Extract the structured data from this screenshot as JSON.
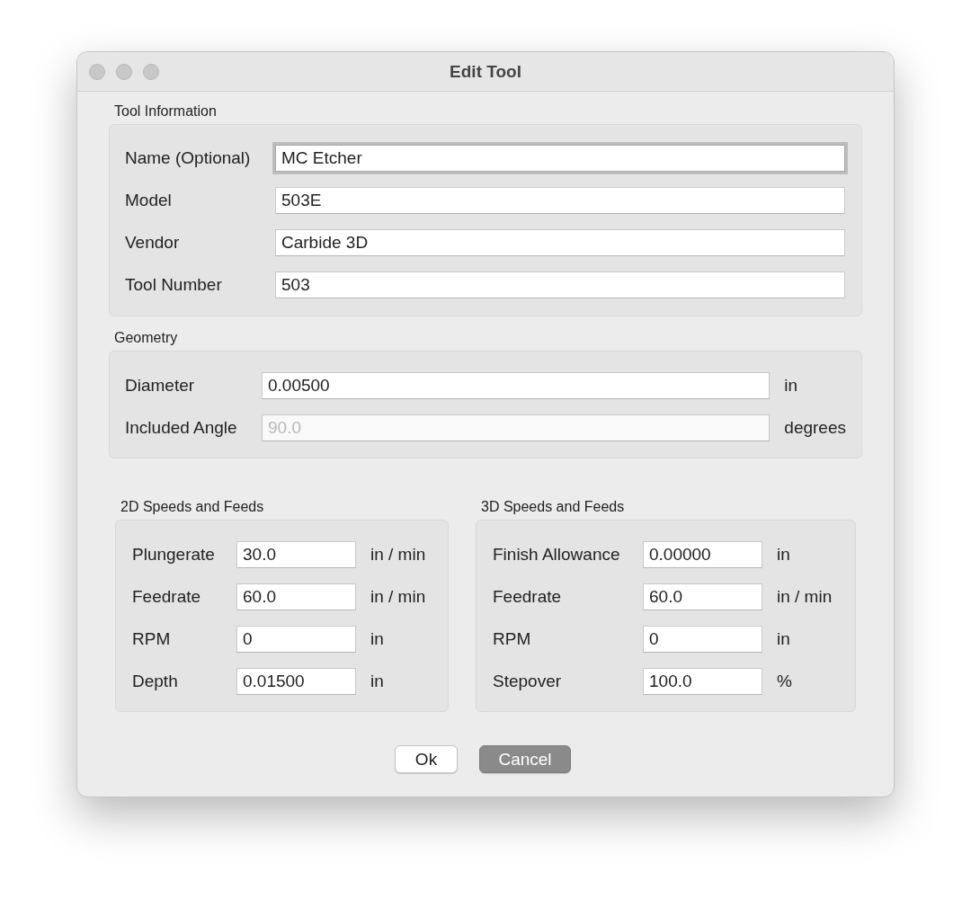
{
  "window": {
    "title": "Edit Tool"
  },
  "tool_information": {
    "title": "Tool Information",
    "fields": [
      {
        "label": "Name (Optional)",
        "value": "MC Etcher",
        "focused": true,
        "disabled": false
      },
      {
        "label": "Model",
        "value": "503E",
        "focused": false,
        "disabled": false
      },
      {
        "label": "Vendor",
        "value": "Carbide 3D",
        "focused": false,
        "disabled": false
      },
      {
        "label": "Tool Number",
        "value": "503",
        "focused": false,
        "disabled": false
      }
    ]
  },
  "geometry": {
    "title": "Geometry",
    "fields": [
      {
        "label": "Diameter",
        "value": "0.00500",
        "unit": "in",
        "focused": false,
        "disabled": false
      },
      {
        "label": "Included Angle",
        "value": "90.0",
        "unit": "degrees",
        "focused": false,
        "disabled": true
      }
    ]
  },
  "speeds_2d": {
    "title": "2D Speeds and Feeds",
    "fields": [
      {
        "label": "Plungerate",
        "value": "30.0",
        "unit": "in / min",
        "focused": false,
        "disabled": false
      },
      {
        "label": "Feedrate",
        "value": "60.0",
        "unit": "in / min",
        "focused": false,
        "disabled": false
      },
      {
        "label": "RPM",
        "value": "0",
        "unit": "in",
        "focused": false,
        "disabled": false
      },
      {
        "label": "Depth",
        "value": "0.01500",
        "unit": "in",
        "focused": false,
        "disabled": false
      }
    ]
  },
  "speeds_3d": {
    "title": "3D Speeds and Feeds",
    "fields": [
      {
        "label": "Finish Allowance",
        "value": "0.00000",
        "unit": "in",
        "focused": false,
        "disabled": false
      },
      {
        "label": "Feedrate",
        "value": "60.0",
        "unit": "in / min",
        "focused": false,
        "disabled": false
      },
      {
        "label": "RPM",
        "value": "0",
        "unit": "in",
        "focused": false,
        "disabled": false
      },
      {
        "label": "Stepover",
        "value": "100.0",
        "unit": "%",
        "focused": false,
        "disabled": false
      }
    ]
  },
  "buttons": [
    {
      "label": "Ok",
      "highlighted": false
    },
    {
      "label": "Cancel",
      "highlighted": true
    }
  ]
}
